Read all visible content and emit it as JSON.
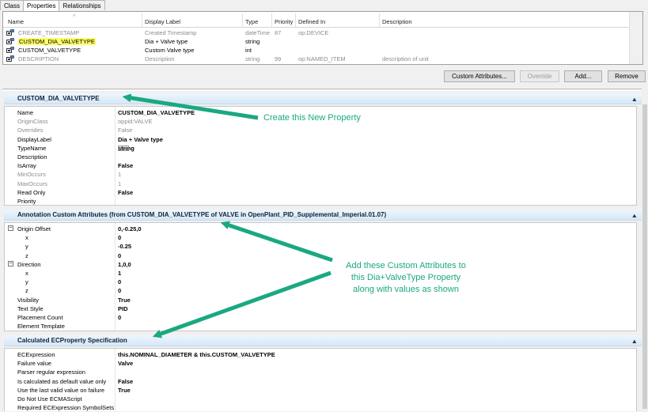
{
  "tabs": [
    "Class",
    "Properties",
    "Relationships"
  ],
  "list": {
    "columns": [
      "Name",
      "Display Label",
      "Type",
      "Priority",
      "Defined In",
      "Description"
    ],
    "rows": [
      {
        "name": "CREATE_TIMESTAMP",
        "label": "Created Timestamp",
        "type": "dateTime",
        "priority": "87",
        "defined_in": "op:DEVICE",
        "description": "",
        "gray": true
      },
      {
        "name": "CUSTOM_DIA_VALVETYPE",
        "label": "Dia + Valve type",
        "type": "string",
        "priority": "",
        "defined_in": "",
        "description": "",
        "highlight": true
      },
      {
        "name": "CUSTOM_VALVETYPE",
        "label": "Custom Valve type",
        "type": "int",
        "priority": "",
        "defined_in": "",
        "description": ""
      },
      {
        "name": "DESCRIPTION",
        "label": "Description",
        "type": "string",
        "priority": "99",
        "defined_in": "op:NAMED_ITEM",
        "description": "description of unit",
        "gray": true
      }
    ]
  },
  "buttons": {
    "custom_attributes": "Custom Attributes...",
    "override": "Override",
    "add": "Add...",
    "remove": "Remove"
  },
  "section1": {
    "title": "CUSTOM_DIA_VALVETYPE",
    "rows": [
      {
        "name": "Name",
        "value": "CUSTOM_DIA_VALVETYPE",
        "bold": true
      },
      {
        "name": "OriginClass",
        "value": "oppid:VALVE",
        "gray": true
      },
      {
        "name": "Overrides",
        "value": "False",
        "gray": true
      },
      {
        "name": "DisplayLabel",
        "value": "Dia + Valve type",
        "bold": true
      },
      {
        "name": "TypeName",
        "value": "string",
        "bold": true,
        "type_icon": true
      },
      {
        "name": "Description",
        "value": ""
      },
      {
        "name": "IsArray",
        "value": "False",
        "bold": true
      },
      {
        "name": "MinOccurs",
        "value": "1",
        "gray": true
      },
      {
        "name": "MaxOccurs",
        "value": "1",
        "gray": true
      },
      {
        "name": "Read Only",
        "value": "False",
        "bold": true
      },
      {
        "name": "Priority",
        "value": ""
      }
    ]
  },
  "section2": {
    "title": "Annotation Custom Attributes (from CUSTOM_DIA_VALVETYPE of VALVE in OpenPlant_PID_Supplemental_Imperial.01.07)",
    "rows": [
      {
        "name": "Origin Offset",
        "value": "0,-0.25,0",
        "bold": true,
        "expander": "⊟"
      },
      {
        "name": "x",
        "value": "0",
        "bold": true,
        "indent": true
      },
      {
        "name": "y",
        "value": "-0.25",
        "bold": true,
        "indent": true
      },
      {
        "name": "z",
        "value": "0",
        "bold": true,
        "indent": true
      },
      {
        "name": "Direction",
        "value": "1,0,0",
        "bold": true,
        "expander": "⊟"
      },
      {
        "name": "x",
        "value": "1",
        "bold": true,
        "indent": true
      },
      {
        "name": "y",
        "value": "0",
        "bold": true,
        "indent": true
      },
      {
        "name": "z",
        "value": "0",
        "bold": true,
        "indent": true
      },
      {
        "name": "Visibility",
        "value": "True",
        "bold": true
      },
      {
        "name": "Text Style",
        "value": "PID",
        "bold": true
      },
      {
        "name": "Placement Count",
        "value": "0",
        "bold": true
      },
      {
        "name": "Element Template",
        "value": ""
      }
    ]
  },
  "section3": {
    "title": "Calculated ECProperty Specification",
    "rows": [
      {
        "name": "ECExpression",
        "value": "this.NOMINAL_DIAMETER & this.CUSTOM_VALVETYPE",
        "bold": true
      },
      {
        "name": "Failure value",
        "value": "Valve",
        "bold": true
      },
      {
        "name": "Parser regular expression",
        "value": ""
      },
      {
        "name": "Is calculated as default value only",
        "value": "False",
        "bold": true
      },
      {
        "name": "Use the last valid value on failure",
        "value": "True",
        "bold": true
      },
      {
        "name": "Do Not Use ECMAScript",
        "value": ""
      },
      {
        "name": "Required ECExpression SymbolSets",
        "value": ""
      }
    ]
  },
  "annotations": {
    "create_new": "Create this New Property",
    "add_attrs_line1": "Add these Custom Attributes to",
    "add_attrs_line2": "this Dia+ValveType Property",
    "add_attrs_line3": "along with values as shown"
  },
  "colors": {
    "annotation": "#1aa882",
    "highlight": "#ffff66",
    "section_bg": "#d5e7f6"
  }
}
